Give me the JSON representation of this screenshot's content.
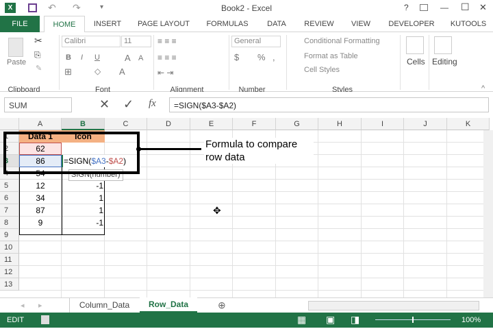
{
  "window": {
    "title": "Book2 - Excel",
    "help": "?",
    "minimize": "—",
    "maximize": "☐",
    "close": "✕"
  },
  "tabs": [
    "FILE",
    "HOME",
    "INSERT",
    "PAGE LAYOUT",
    "FORMULAS",
    "DATA",
    "REVIEW",
    "VIEW",
    "DEVELOPER",
    "KUTOOLS"
  ],
  "ribbon": {
    "clipboard": {
      "label": "Clipboard",
      "paste": "Paste"
    },
    "font": {
      "label": "Font",
      "name": "Calibri",
      "size": "11"
    },
    "alignment": {
      "label": "Alignment"
    },
    "number": {
      "label": "Number",
      "format": "General",
      "currency": "$",
      "percent": "%",
      "comma": ","
    },
    "styles": {
      "label": "Styles",
      "conditional": "Conditional Formatting",
      "format_table": "Format as Table",
      "cell_styles": "Cell Styles"
    },
    "cells": {
      "label": "Cells"
    },
    "editing": {
      "label": "Editing"
    }
  },
  "formula_bar": {
    "name_box": "SUM",
    "formula": "=SIGN($A3-$A2)",
    "fx": "fx"
  },
  "columns": [
    "A",
    "B",
    "C",
    "D",
    "E",
    "F",
    "G",
    "H",
    "I",
    "J",
    "K"
  ],
  "rows": [
    "1",
    "2",
    "3",
    "4",
    "5",
    "6",
    "7",
    "8",
    "9",
    "10",
    "11",
    "12",
    "13"
  ],
  "cells": {
    "A1": "Data 1",
    "B1": "Icon",
    "A2": "62",
    "A3": "86",
    "A4": "54",
    "A5": "12",
    "A6": "34",
    "A7": "87",
    "A8": "9",
    "B5": "-1",
    "B6": "1",
    "B7": "1",
    "B8": "-1"
  },
  "edit_formula": {
    "prefix": "=SIGN(",
    "ref1": "$A3",
    "minus": "-",
    "ref2": "$A2",
    "suffix": ")"
  },
  "tooltip": "SIGN(number)",
  "annotation": "Formula to compare row data",
  "sheets": [
    {
      "name": "Column_Data",
      "active": false
    },
    {
      "name": "Row_Data",
      "active": true
    }
  ],
  "status": {
    "mode": "EDIT",
    "zoom": "100%"
  },
  "colors": {
    "excel_green": "#217346",
    "header_orange": "#f4b183",
    "ref1_blue": "#4472c4",
    "ref2_red": "#c0504d"
  }
}
